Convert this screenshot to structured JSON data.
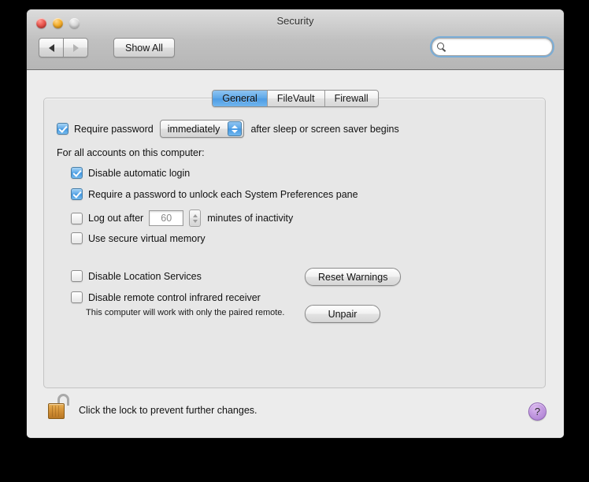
{
  "window": {
    "title": "Security",
    "traffic_lights": [
      "close",
      "minimize",
      "zoom"
    ]
  },
  "toolbar": {
    "back_label": "",
    "forward_label": "",
    "show_all_label": "Show All",
    "search_placeholder": "",
    "search_value": ""
  },
  "tabs": [
    {
      "label": "General",
      "active": true
    },
    {
      "label": "FileVault",
      "active": false
    },
    {
      "label": "Firewall",
      "active": false
    }
  ],
  "general": {
    "require_password": {
      "checked": true,
      "prefix": "Require password",
      "popup_value": "immediately",
      "suffix": "after sleep or screen saver begins"
    },
    "section_header": "For all accounts on this computer:",
    "disable_automatic_login": {
      "checked": true,
      "label": "Disable automatic login"
    },
    "require_password_prefs": {
      "checked": true,
      "label": "Require a password to unlock each System Preferences pane"
    },
    "log_out_after": {
      "checked": false,
      "prefix": "Log out after",
      "minutes_value": "60",
      "suffix": "minutes of inactivity"
    },
    "secure_virtual_memory": {
      "checked": false,
      "label": "Use secure virtual memory"
    },
    "disable_location_services": {
      "checked": false,
      "label": "Disable Location Services"
    },
    "disable_infrared": {
      "checked": false,
      "label": "Disable remote control infrared receiver"
    },
    "infrared_help": "This computer will work with only the paired remote.",
    "reset_warnings_label": "Reset Warnings",
    "unpair_label": "Unpair"
  },
  "footer": {
    "lock_caption": "Click the lock to prevent further changes.",
    "lock_state": "unlocked",
    "help_label": "?"
  },
  "colors": {
    "accent_blue": "#4e9ce4",
    "help_purple": "#c299e0",
    "lock_gold": "#d9983d"
  }
}
